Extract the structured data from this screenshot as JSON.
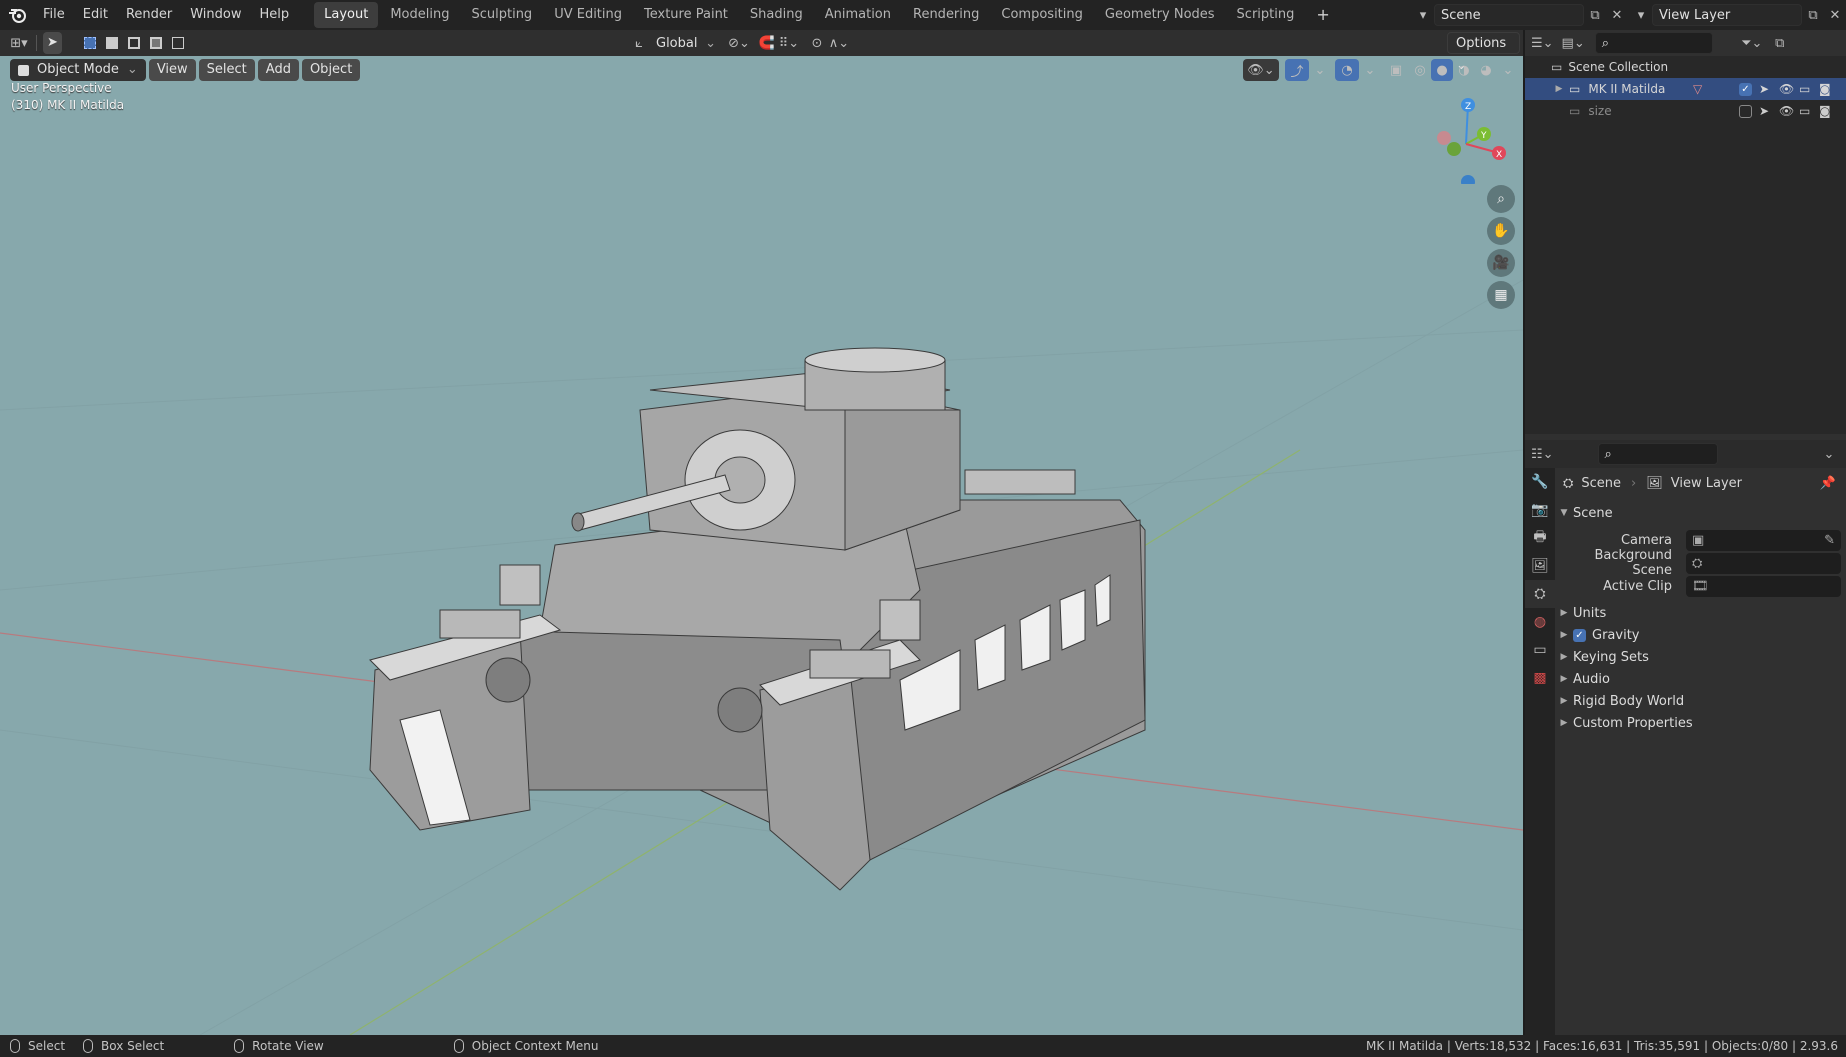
{
  "app_menu": [
    "File",
    "Edit",
    "Render",
    "Window",
    "Help"
  ],
  "workspaces": [
    "Layout",
    "Modeling",
    "Sculpting",
    "UV Editing",
    "Texture Paint",
    "Shading",
    "Animation",
    "Rendering",
    "Compositing",
    "Geometry Nodes",
    "Scripting"
  ],
  "active_workspace": "Layout",
  "scene_field": "Scene",
  "view_layer_field": "View Layer",
  "toolbar": {
    "transform_orientation": "Global",
    "options_label": "Options"
  },
  "viewport_header": {
    "mode": "Object Mode",
    "menus": [
      "View",
      "Select",
      "Add",
      "Object"
    ]
  },
  "viewport": {
    "perspective_label": "User Perspective",
    "object_label": "(310) MK II Matilda",
    "gizmo_axes": {
      "x": "X",
      "y": "Y",
      "z": "Z"
    }
  },
  "outliner": {
    "root": "Scene Collection",
    "rows": [
      {
        "label": "MK II Matilda",
        "selected": true,
        "checked": true
      },
      {
        "label": "size",
        "selected": false,
        "checked": false
      }
    ]
  },
  "properties": {
    "breadcrumb": [
      "Scene",
      "View Layer"
    ],
    "section": "Scene",
    "fields": [
      {
        "label": "Camera"
      },
      {
        "label": "Background Scene"
      },
      {
        "label": "Active Clip"
      }
    ],
    "panels": [
      {
        "label": "Units",
        "checkbox": false
      },
      {
        "label": "Gravity",
        "checkbox": true
      },
      {
        "label": "Keying Sets",
        "checkbox": false
      },
      {
        "label": "Audio",
        "checkbox": false
      },
      {
        "label": "Rigid Body World",
        "checkbox": false
      },
      {
        "label": "Custom Properties",
        "checkbox": false
      }
    ]
  },
  "status_bar": {
    "hints": [
      "Select",
      "Box Select",
      "Rotate View",
      "Object Context Menu"
    ],
    "stats": "MK II Matilda | Verts:18,532 | Faces:16,631 | Tris:35,591 | Objects:0/80 | 2.93.6"
  },
  "colors": {
    "viewport_bg": "#87a8ac",
    "selection": "#334d80",
    "accent": "#4772b3",
    "axis_x": "#e0475a",
    "axis_y": "#7bbd32",
    "axis_z": "#3f8fe0"
  }
}
